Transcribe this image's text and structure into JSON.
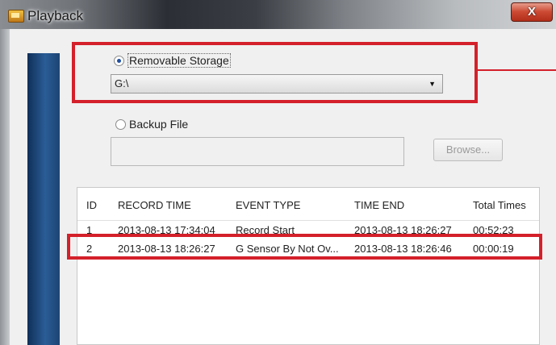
{
  "window": {
    "title": "Playback",
    "close_label": "X"
  },
  "storage": {
    "removable_label": "Removable Storage",
    "removable_selected": true,
    "drive_value": "G:\\",
    "backup_label": "Backup File",
    "backup_selected": false,
    "backup_path": "",
    "browse_label": "Browse..."
  },
  "table": {
    "headers": [
      "ID",
      "RECORD TIME",
      "EVENT TYPE",
      "TIME END",
      "Total Times"
    ],
    "rows": [
      [
        "1",
        "2013-08-13 17:34:04",
        "Record Start",
        "2013-08-13 18:26:27",
        "00:52:23"
      ],
      [
        "2",
        "2013-08-13 18:26:27",
        "G Sensor By Not Ov...",
        "2013-08-13 18:26:46",
        "00:00:19"
      ]
    ]
  },
  "colors": {
    "highlight": "#d4202a",
    "sidebar": "#1d4473"
  }
}
